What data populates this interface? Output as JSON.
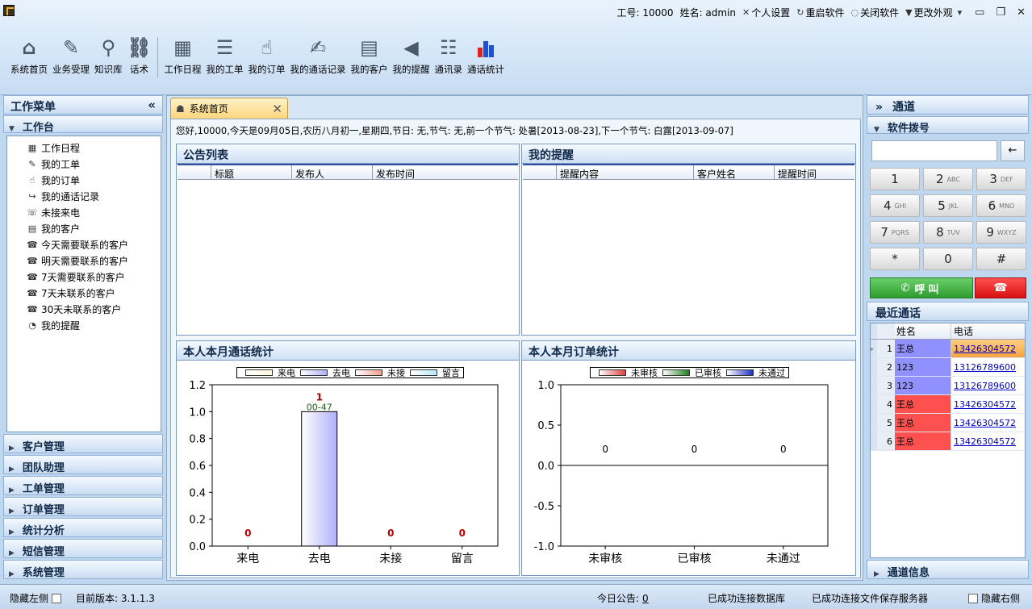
{
  "header": {
    "employee_id_label": "工号: 10000",
    "name_label": "姓名: admin",
    "personal_settings": "个人设置",
    "restart": "重启软件",
    "close": "关闭软件",
    "change_skin": "更改外观"
  },
  "toolbar": [
    {
      "label": "系统首页",
      "icon": "home-icon",
      "color": "#4a5868"
    },
    {
      "label": "业务受理",
      "icon": "edit-icon",
      "color": "#4a5868"
    },
    {
      "label": "知识库",
      "icon": "search-icon",
      "color": "#4a5868"
    },
    {
      "label": "话术",
      "icon": "link-icon",
      "color": "#4a5868"
    },
    {
      "label": "工作日程",
      "icon": "calendar-icon",
      "color": "#4a5868"
    },
    {
      "label": "我的工单",
      "icon": "users-list-icon",
      "color": "#4a5868"
    },
    {
      "label": "我的订单",
      "icon": "order-icon",
      "color": "#4a5868"
    },
    {
      "label": "我的通话记录",
      "icon": "call-record-icon",
      "color": "#4a5868"
    },
    {
      "label": "我的客户",
      "icon": "contact-card-icon",
      "color": "#4a5868"
    },
    {
      "label": "我的提醒",
      "icon": "speaker-icon",
      "color": "#4a5868"
    },
    {
      "label": "通讯录",
      "icon": "address-book-icon",
      "color": "#4a5868"
    },
    {
      "label": "通话统计",
      "icon": "bar-chart-icon",
      "color": "#4a5868"
    }
  ],
  "left_menu": {
    "title": "工作菜单",
    "collapse": "«",
    "workbench": "工作台",
    "items": [
      "工作日程",
      "我的工单",
      "我的订单",
      "我的通话记录",
      "未接来电",
      "我的客户",
      "今天需要联系的客户",
      "明天需要联系的客户",
      "7天需要联系的客户",
      "7天未联系的客户",
      "30天未联系的客户",
      "我的提醒"
    ],
    "sections": [
      "客户管理",
      "团队助理",
      "工单管理",
      "订单管理",
      "统计分析",
      "短信管理",
      "系统管理"
    ]
  },
  "tab": {
    "label": "系统首页",
    "close": "✕"
  },
  "greeting": "您好,10000,今天是09月05日,农历八月初一,星期四,节日: 无,节气: 无,前一个节气: 处暑[2013-08-23],下一个节气: 白露[2013-09-07]",
  "announcements": {
    "title": "公告列表",
    "columns": [
      "",
      "标题",
      "发布人",
      "发布时间"
    ]
  },
  "reminders": {
    "title": "我的提醒",
    "columns": [
      "",
      "提醒内容",
      "客户姓名",
      "提醒时间"
    ]
  },
  "call_stats": {
    "title": "本人本月通话统计"
  },
  "order_stats": {
    "title": "本人本月订单统计"
  },
  "chart_data": [
    {
      "type": "bar",
      "categories": [
        "来电",
        "去电",
        "未接",
        "留言"
      ],
      "series": [
        {
          "name": "来电",
          "color": "#fff8dc"
        },
        {
          "name": "去电",
          "color": "#b0b0f8"
        },
        {
          "name": "未接",
          "color": "#f0a090"
        },
        {
          "name": "留言",
          "color": "#b8e8f8"
        }
      ],
      "values": [
        0,
        1,
        0,
        0
      ],
      "data_labels": [
        "0",
        "1",
        "0",
        "0"
      ],
      "extra_labels": [
        "",
        "00-47",
        "",
        ""
      ],
      "ylim": [
        0,
        1.2
      ],
      "yticks": [
        "0.0",
        "0.2",
        "0.4",
        "0.6",
        "0.8",
        "1.0",
        "1.2"
      ],
      "ytick_values": [
        0,
        0.2,
        0.4,
        0.6,
        0.8,
        1.0,
        1.2
      ]
    },
    {
      "type": "bar",
      "categories": [
        "未审核",
        "已审核",
        "未通过"
      ],
      "series": [
        {
          "name": "未审核",
          "color": "#e04040"
        },
        {
          "name": "已审核",
          "color": "#208020"
        },
        {
          "name": "未通过",
          "color": "#2030c0"
        }
      ],
      "values": [
        0,
        0,
        0
      ],
      "data_labels": [
        "0",
        "0",
        "0"
      ],
      "ylim": [
        -1.0,
        1.0
      ],
      "yticks": [
        "-1.0",
        "-0.5",
        "0.0",
        "0.5",
        "1.0"
      ],
      "ytick_values": [
        -1.0,
        -0.5,
        0.0,
        0.5,
        1.0
      ]
    }
  ],
  "right_panel": {
    "title": "通道",
    "expand": "»",
    "dial_title": "软件拨号",
    "backspace": "←",
    "keys": [
      [
        "1",
        ""
      ],
      [
        "2",
        "ABC"
      ],
      [
        "3",
        "DEF"
      ],
      [
        "4",
        "GHI"
      ],
      [
        "5",
        "JKL"
      ],
      [
        "6",
        "MNO"
      ],
      [
        "7",
        "PQRS"
      ],
      [
        "8",
        "TUV"
      ],
      [
        "9",
        "WXYZ"
      ],
      [
        "*",
        ""
      ],
      [
        "0",
        ""
      ],
      [
        "#",
        ""
      ]
    ],
    "call_label": "呼叫",
    "recent_title": "最近通话",
    "recent_columns": [
      "姓名",
      "电话"
    ],
    "recent": [
      {
        "n": "1",
        "name": "王总",
        "phone": "13426304572",
        "color": "#9090ff",
        "selected": true
      },
      {
        "n": "2",
        "name": "123",
        "phone": "13126789600",
        "color": "#9090ff"
      },
      {
        "n": "3",
        "name": "123",
        "phone": "13126789600",
        "color": "#9090ff"
      },
      {
        "n": "4",
        "name": "王总",
        "phone": "13426304572",
        "color": "#ff5050"
      },
      {
        "n": "5",
        "name": "王总",
        "phone": "13426304572",
        "color": "#ff5050"
      },
      {
        "n": "6",
        "name": "王总",
        "phone": "13426304572",
        "color": "#ff5050"
      }
    ],
    "channel_info": "通道信息"
  },
  "status": {
    "hide_left": "隐藏左侧",
    "version": "目前版本: 3.1.1.3",
    "today_notice_label": "今日公告:",
    "today_notice_count": "0",
    "db_status": "已成功连接数据库",
    "file_status": "已成功连接文件保存服务器",
    "hide_right": "隐藏右侧"
  }
}
